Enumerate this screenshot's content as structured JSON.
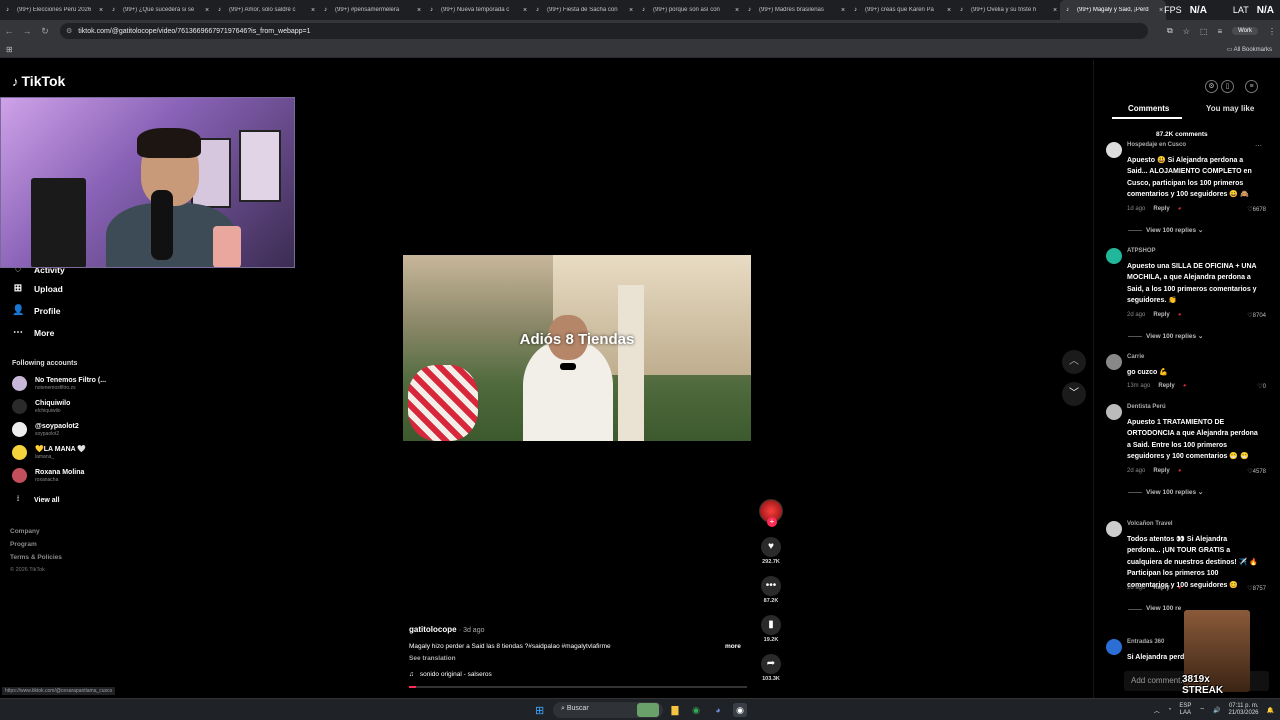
{
  "tabs": [
    {
      "label": "(99+) Elecciones Perú 2026"
    },
    {
      "label": "(99+) ¿Qué sucederá si se"
    },
    {
      "label": "(99+) Amor, solo saldré c"
    },
    {
      "label": "(99+) #pensamermelera"
    },
    {
      "label": "(99+) Nueva temporada c"
    },
    {
      "label": "(99+) Fiesta de Sacha con"
    },
    {
      "label": "(99+) porque son así con"
    },
    {
      "label": "(99+) Madres brasileñas"
    },
    {
      "label": "(99+) creas que Karen Pa"
    },
    {
      "label": "(99+) Ovelia y su triste h"
    },
    {
      "label": "(99+) Magaly y Said, ¡Perd"
    }
  ],
  "overlay": {
    "fps_label": "FPS",
    "fps_value": "N/A",
    "lat_label": "LAT",
    "lat_value": "N/A"
  },
  "address": {
    "url": "tiktok.com/@gatitolocope/video/761366966797197646?is_from_webapp=1",
    "profile": "Work"
  },
  "bookmarks": {
    "all": "All Bookmarks"
  },
  "brand": {
    "name": "TikTok"
  },
  "nav": {
    "activity": "Activity",
    "upload": "Upload",
    "profile": "Profile",
    "more": "More"
  },
  "following": {
    "title": "Following accounts",
    "accounts": [
      {
        "name": "No Tenemos Filtro (...",
        "handle": "notenemosfiltro.zs"
      },
      {
        "name": "Chiquiwilo",
        "handle": "elchiquiwilo"
      },
      {
        "name": "@soypaolot2",
        "handle": "soypaolot2"
      },
      {
        "name": "💛LA MANA 🤍",
        "handle": "lamana_"
      },
      {
        "name": "Roxana Molina",
        "handle": "roxanacha"
      }
    ],
    "view_all": "View all"
  },
  "footer": {
    "company": "Company",
    "program": "Program",
    "terms": "Terms & Policies",
    "copyright": "© 2026 TikTok"
  },
  "status_url": "https://www.tiktok.com/@cesarapantiama_cusco",
  "video": {
    "caption": "Adiós 8 Tiendas",
    "author": "gatitolocope",
    "ago": "· 3d ago",
    "description": "Magaly hizo perder a Said las 8 tiendas ?#saidpalao #magalytvlafirme",
    "more": "more",
    "see_translation": "See translation",
    "music": "sonido original - salseros",
    "progress": 0.02
  },
  "actions": {
    "likes": "292.7K",
    "comments": "87.2K",
    "saves": "19.2K",
    "shares": "103.3K"
  },
  "panel": {
    "tab_comments": "Comments",
    "tab_may_like": "You may like",
    "comments_count": "87.2K comments",
    "comments": [
      {
        "user": "Hospedaje en Cusco",
        "text": "Apuesto 😃 Si Alejandra perdona a Said... ALOJAMIENTO COMPLETO en Cusco, participan los 100 primeros comentarios y 100 seguidores 😀 🙈",
        "ago": "1d ago",
        "reply": "Reply",
        "likes": "6678",
        "view_replies": "View 100 replies ⌄"
      },
      {
        "user": "ATPSHOP",
        "text": "Apuesto una SILLA DE OFICINA + UNA MOCHILA, a que Alejandra perdona a Said, a los 100 primeros comentarios y seguidores. 👏",
        "ago": "2d ago",
        "reply": "Reply",
        "likes": "8704",
        "view_replies": "View 100 replies ⌄"
      },
      {
        "user": "Carrie",
        "text": "go cuzco 💪",
        "ago": "13m ago",
        "reply": "Reply",
        "likes": "0",
        "view_replies": ""
      },
      {
        "user": "Dentista Perú",
        "text": "Apuesto 1 TRATAMIENTO DE ORTODONCIA a que Alejandra perdona a Said. Entre los 100 primeros seguidores y 100 comentarios 😁 😁",
        "ago": "2d ago",
        "reply": "Reply",
        "likes": "4578",
        "view_replies": "View 100 replies ⌄"
      },
      {
        "user": "Volcañon Travel",
        "text": "Todos atentos 👀 Si Alejandra perdona... ¡UN TOUR GRATIS a cualquiera de nuestros destinos! ✈️ 🔥 Participan los primeros 100 comentarios y 100 seguidores 😊",
        "ago": "2d ago",
        "reply": "Reply",
        "likes": "8757",
        "view_replies": "View 100 re"
      },
      {
        "user": "Entradas 360",
        "text": "Si Alejandra perd",
        "ago": "",
        "reply": "",
        "likes": "",
        "view_replies": ""
      }
    ],
    "add_comment": "Add comment..."
  },
  "streak": "3819x STREAK",
  "taskbar": {
    "search": "Buscar",
    "lang1": "ESP",
    "lang2": "LAA",
    "time": "07:11 p. m.",
    "date": "21/03/2026"
  }
}
